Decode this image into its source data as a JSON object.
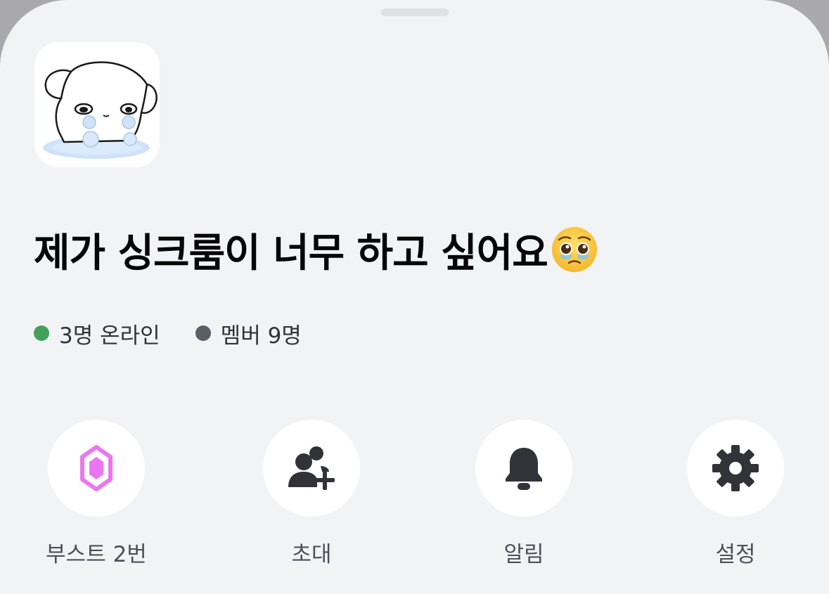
{
  "server": {
    "name": "제가 싱크룸이 너무 하고 싶어요",
    "name_emoji": "pleading-face-with-tear-icon",
    "icon": "crying-puppy-avatar"
  },
  "stats": {
    "online": {
      "text": "3명 온라인",
      "dot_color": "#43a25a"
    },
    "members": {
      "text": "멤버 9명",
      "dot_color": "#5c5e66"
    }
  },
  "actions": [
    {
      "label": "부스트 2번",
      "icon": "boost-gem-icon",
      "icon_color": "#eb77f0"
    },
    {
      "label": "초대",
      "icon": "add-members-icon",
      "icon_color": "#313338"
    },
    {
      "label": "알림",
      "icon": "bell-icon",
      "icon_color": "#313338"
    },
    {
      "label": "설정",
      "icon": "gear-icon",
      "icon_color": "#313338"
    }
  ],
  "colors": {
    "sheet_background": "#f2f3f5",
    "title_text": "#060607",
    "secondary_text": "#4e5058"
  }
}
